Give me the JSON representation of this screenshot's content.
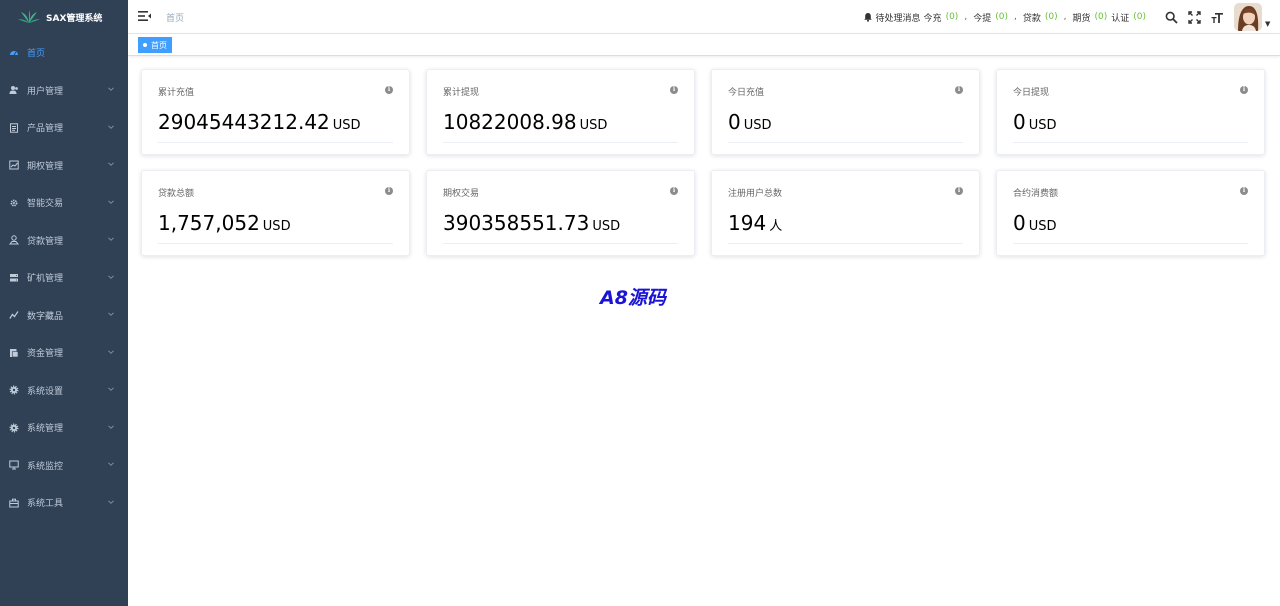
{
  "app": {
    "title": "SAX管理系统"
  },
  "sidebar": {
    "items": [
      {
        "label": "首页",
        "icon": "dashboard-icon",
        "active": true,
        "expandable": false
      },
      {
        "label": "用户管理",
        "icon": "user-icon",
        "expandable": true
      },
      {
        "label": "产品管理",
        "icon": "document-icon",
        "expandable": true
      },
      {
        "label": "期权管理",
        "icon": "chart-icon",
        "expandable": true
      },
      {
        "label": "智能交易",
        "icon": "cog-small-icon",
        "expandable": true
      },
      {
        "label": "贷款管理",
        "icon": "loan-icon",
        "expandable": true
      },
      {
        "label": "矿机管理",
        "icon": "server-icon",
        "expandable": true
      },
      {
        "label": "数字藏品",
        "icon": "trend-icon",
        "expandable": true
      },
      {
        "label": "资金管理",
        "icon": "money-icon",
        "expandable": true
      },
      {
        "label": "系统设置",
        "icon": "gear-icon",
        "expandable": true
      },
      {
        "label": "系统管理",
        "icon": "gear-icon",
        "expandable": true
      },
      {
        "label": "系统监控",
        "icon": "monitor-icon",
        "expandable": true
      },
      {
        "label": "系统工具",
        "icon": "toolbox-icon",
        "expandable": true
      }
    ]
  },
  "header": {
    "breadcrumb": "首页",
    "notice": {
      "label": "待处理消息",
      "items": [
        {
          "label": "今充",
          "count": "(0)"
        },
        {
          "label": "今提",
          "count": "(0)"
        },
        {
          "label": "贷款",
          "count": "(0)"
        },
        {
          "label": "期货",
          "count": "(0)"
        },
        {
          "label": "认证",
          "count": "(0)"
        }
      ],
      "separator": ","
    }
  },
  "tags": [
    {
      "label": "首页",
      "active": true
    }
  ],
  "cards": [
    {
      "title": "累计充值",
      "value": "29045443212.42",
      "unit": "USD"
    },
    {
      "title": "累计提现",
      "value": "10822008.98",
      "unit": "USD"
    },
    {
      "title": "今日充值",
      "value": "0",
      "unit": "USD"
    },
    {
      "title": "今日提现",
      "value": "0",
      "unit": "USD"
    },
    {
      "title": "贷款总额",
      "value": "1,757,052",
      "unit": "USD"
    },
    {
      "title": "期权交易",
      "value": "390358551.73",
      "unit": "USD"
    },
    {
      "title": "注册用户总数",
      "value": "194",
      "unit": "人"
    },
    {
      "title": "合约消费额",
      "value": "0",
      "unit": "USD"
    }
  ],
  "watermark": "A8源码",
  "colors": {
    "sidebar_bg": "#304156",
    "sidebar_text": "#bfcbd9",
    "active": "#409eff",
    "count": "#67c23a",
    "watermark": "#1a14d6"
  }
}
